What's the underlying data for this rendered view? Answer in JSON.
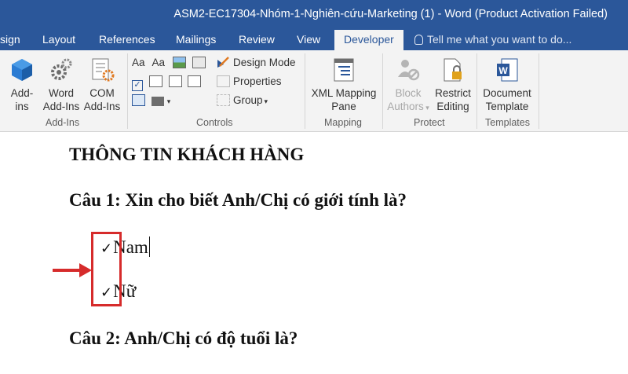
{
  "window": {
    "title": "ASM2-EC17304-Nhóm-1-Nghiên-cứu-Marketing (1) - Word (Product Activation Failed)"
  },
  "tabs": [
    {
      "label": "sign"
    },
    {
      "label": "Layout"
    },
    {
      "label": "References"
    },
    {
      "label": "Mailings"
    },
    {
      "label": "Review"
    },
    {
      "label": "View"
    },
    {
      "label": "Developer",
      "active": true
    }
  ],
  "tell_me": {
    "placeholder": "Tell me what you want to do..."
  },
  "ribbon": {
    "addins": {
      "label": "Add-Ins",
      "buttons": [
        {
          "l1": "Add-",
          "l2": "ins",
          "icon": "addins-cube-icon"
        },
        {
          "l1": "Word",
          "l2": "Add-Ins",
          "icon": "gear-icon"
        },
        {
          "l1": "COM",
          "l2": "Add-Ins",
          "icon": "com-addins-icon"
        }
      ]
    },
    "controls": {
      "label": "Controls",
      "design_mode": "Design Mode",
      "properties": "Properties",
      "group": "Group"
    },
    "mapping": {
      "label": "Mapping",
      "xml_l1": "XML Mapping",
      "xml_l2": "Pane"
    },
    "protect": {
      "label": "Protect",
      "block_l1": "Block",
      "block_l2": "Authors",
      "restrict_l1": "Restrict",
      "restrict_l2": "Editing"
    },
    "templates": {
      "label": "Templates",
      "doc_l1": "Document",
      "doc_l2": "Template"
    }
  },
  "document": {
    "heading": "THÔNG TIN KHÁCH HÀNG",
    "q1": "Câu 1: Xin cho biết Anh/Chị có giới tính là?",
    "q1_options": [
      {
        "check": "✓",
        "text": "Nam"
      },
      {
        "check": "✓",
        "text": "Nữ"
      }
    ],
    "q2": "Câu 2: Anh/Chị có độ tuổi là?"
  },
  "colors": {
    "title_bar": "#2b579a",
    "ribbon": "#f3f3f3",
    "annotation": "#d62b2b"
  }
}
